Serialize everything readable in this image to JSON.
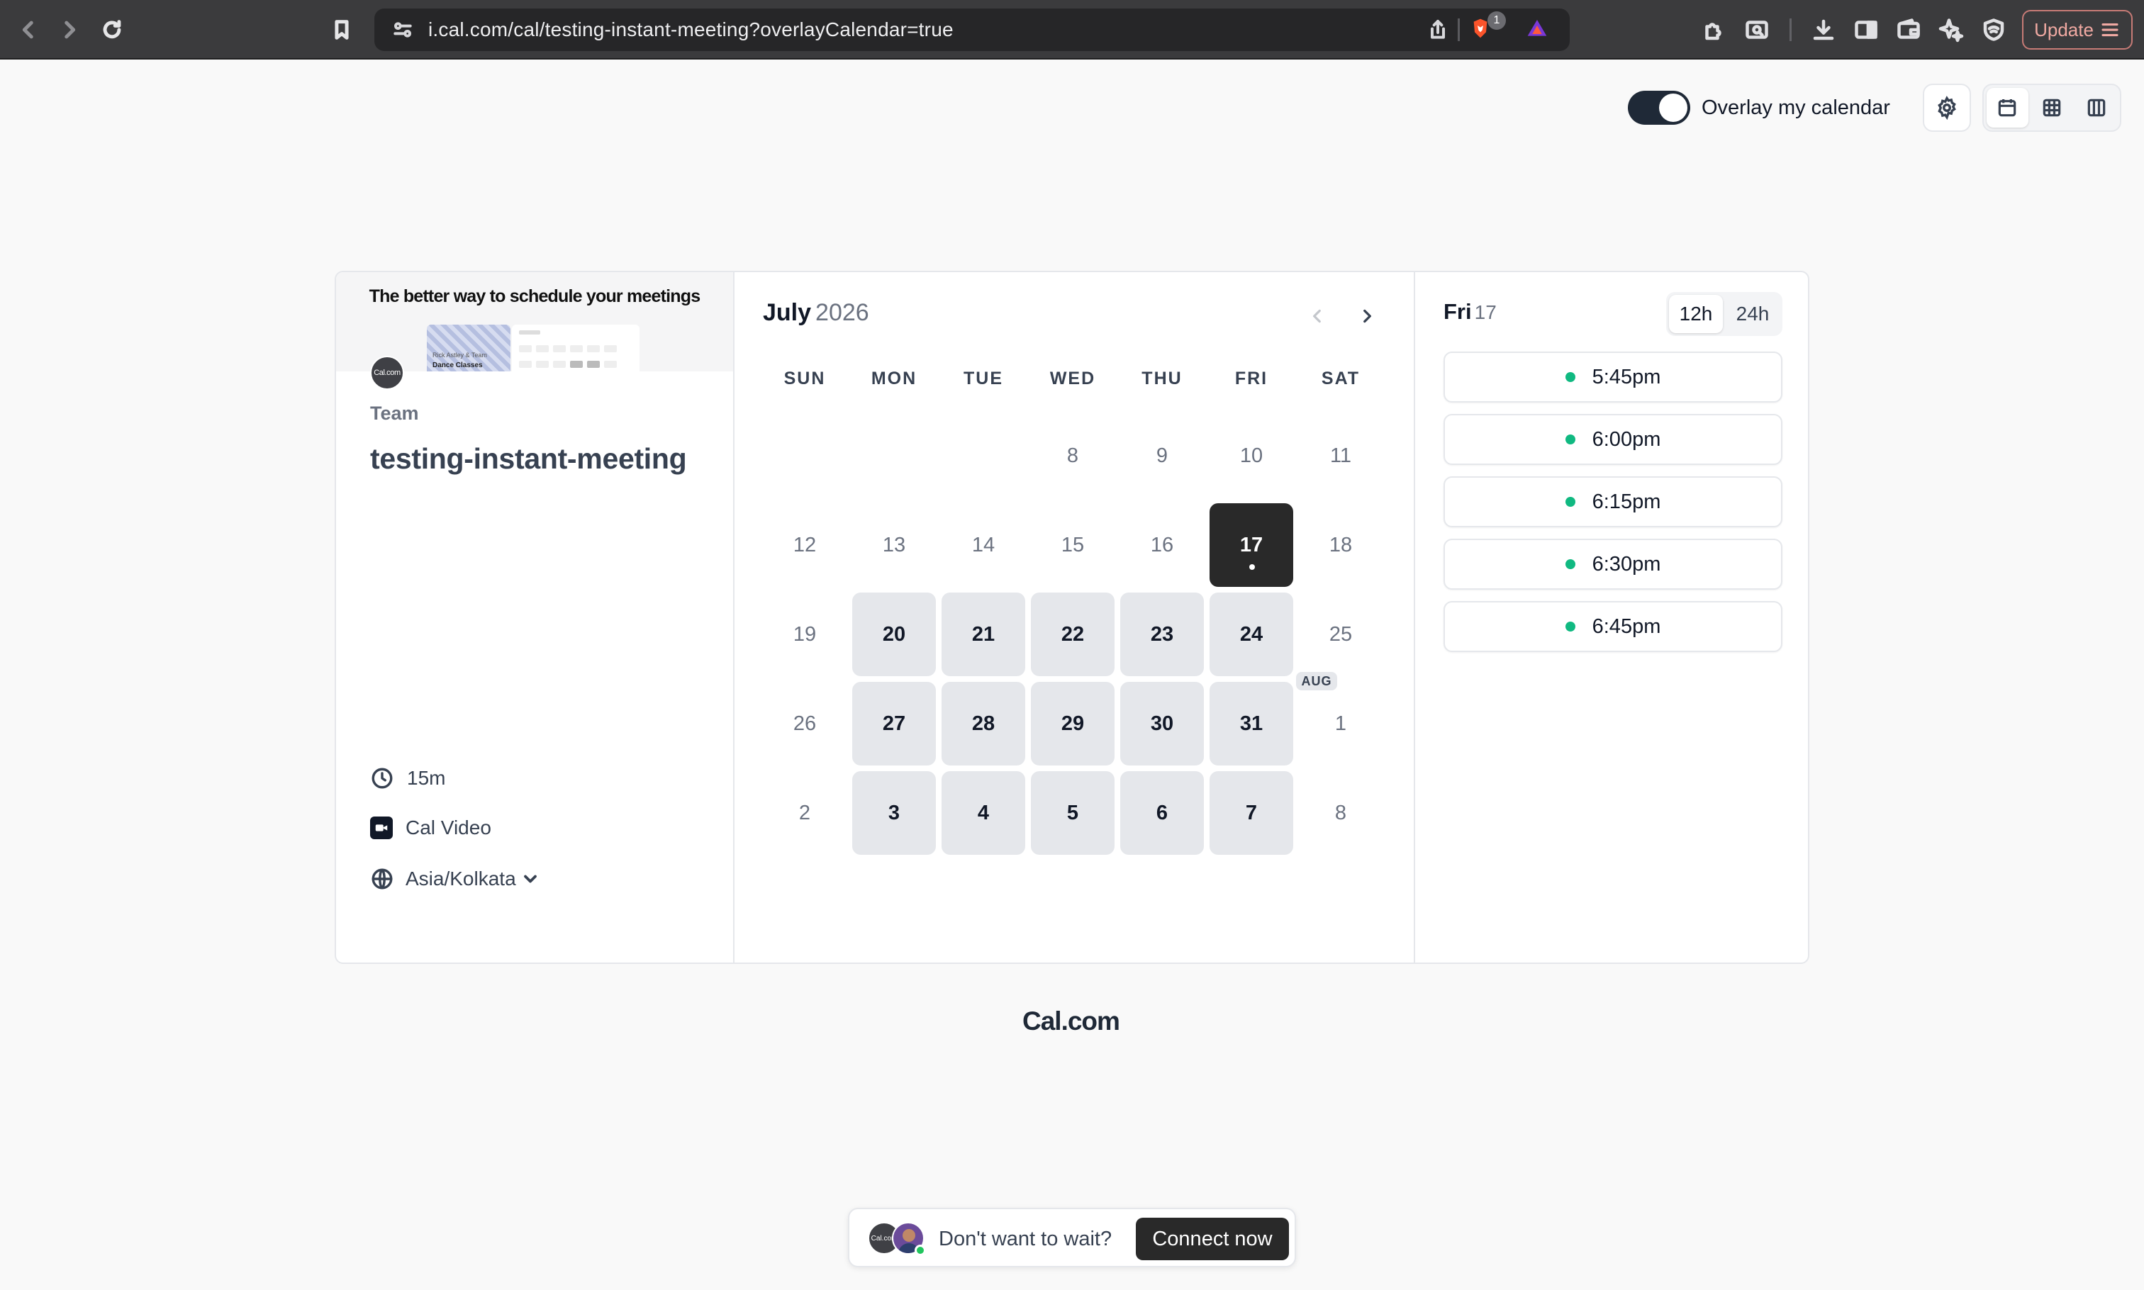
{
  "browser": {
    "url": "i.cal.com/cal/testing-instant-meeting?overlayCalendar=true",
    "shields_count": "1",
    "update_label": "Update"
  },
  "header": {
    "overlay_label": "Overlay my calendar",
    "overlay_enabled": true
  },
  "event": {
    "banner_title": "The better way to schedule your meetings",
    "banner_mini_text1": "Rick Astley & Team",
    "banner_mini_text2": "Dance Classes",
    "org_avatar": "Cal.com",
    "team": "Team",
    "title": "testing-instant-meeting",
    "duration": "15m",
    "location": "Cal Video",
    "timezone": "Asia/Kolkata"
  },
  "calendar": {
    "month": "July",
    "year": "2026",
    "weekdays": [
      "SUN",
      "MON",
      "TUE",
      "WED",
      "THU",
      "FRI",
      "SAT"
    ],
    "next_month_badge": "AUG",
    "days": [
      {
        "label": "8",
        "state": "disabled"
      },
      {
        "label": "9",
        "state": "disabled"
      },
      {
        "label": "10",
        "state": "disabled"
      },
      {
        "label": "11",
        "state": "disabled"
      },
      {
        "label": "12",
        "state": "disabled"
      },
      {
        "label": "13",
        "state": "disabled"
      },
      {
        "label": "14",
        "state": "disabled"
      },
      {
        "label": "15",
        "state": "disabled"
      },
      {
        "label": "16",
        "state": "disabled"
      },
      {
        "label": "17",
        "state": "selected"
      },
      {
        "label": "18",
        "state": "disabled"
      },
      {
        "label": "19",
        "state": "disabled"
      },
      {
        "label": "20",
        "state": "available"
      },
      {
        "label": "21",
        "state": "available"
      },
      {
        "label": "22",
        "state": "available"
      },
      {
        "label": "23",
        "state": "available"
      },
      {
        "label": "24",
        "state": "available"
      },
      {
        "label": "25",
        "state": "disabled"
      },
      {
        "label": "26",
        "state": "disabled"
      },
      {
        "label": "27",
        "state": "available"
      },
      {
        "label": "28",
        "state": "available"
      },
      {
        "label": "29",
        "state": "available"
      },
      {
        "label": "30",
        "state": "available"
      },
      {
        "label": "31",
        "state": "available"
      },
      {
        "label": "1",
        "state": "disabled"
      },
      {
        "label": "2",
        "state": "disabled"
      },
      {
        "label": "3",
        "state": "available"
      },
      {
        "label": "4",
        "state": "available"
      },
      {
        "label": "5",
        "state": "available"
      },
      {
        "label": "6",
        "state": "available"
      },
      {
        "label": "7",
        "state": "available"
      },
      {
        "label": "8",
        "state": "disabled"
      }
    ]
  },
  "slots": {
    "day_name": "Fri",
    "day_num": "17",
    "format_12h": "12h",
    "format_24h": "24h",
    "times": [
      "5:45pm",
      "6:00pm",
      "6:15pm",
      "6:30pm",
      "6:45pm"
    ]
  },
  "footer": {
    "brand": "Cal.com"
  },
  "instant": {
    "avatar_text": "Cal.com",
    "prompt": "Don't want to wait?",
    "connect_label": "Connect now"
  },
  "colors": {
    "selected_day": "#292929",
    "available_day": "#e5e7eb",
    "slot_dot": "#10b981"
  }
}
